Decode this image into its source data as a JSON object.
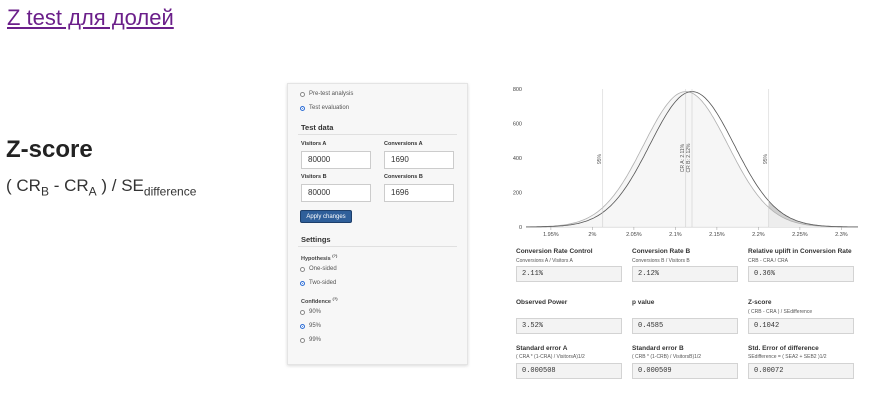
{
  "page_title": "Z test для долей",
  "zscore": {
    "heading": "Z-score",
    "formula_open": "( CR",
    "formula_sub_b": "B",
    "formula_minus": " - CR",
    "formula_sub_a": "A",
    "formula_close": " ) / SE",
    "formula_sub_diff": "difference"
  },
  "analysis_type": {
    "options": [
      {
        "label": "Pre-test analysis",
        "selected": false
      },
      {
        "label": "Test evaluation",
        "selected": true
      }
    ]
  },
  "test_data": {
    "heading": "Test data",
    "visitors_a_label": "Visitors A",
    "visitors_a": "80000",
    "conversions_a_label": "Conversions A",
    "conversions_a": "1690",
    "visitors_b_label": "Visitors B",
    "visitors_b": "80000",
    "conversions_b_label": "Conversions B",
    "conversions_b": "1696",
    "apply_label": "Apply changes"
  },
  "settings": {
    "heading": "Settings",
    "hypothesis_label": "Hypothesis",
    "hypothesis_sup": "(?)",
    "hypothesis_options": [
      {
        "label": "One-sided",
        "selected": false
      },
      {
        "label": "Two-sided",
        "selected": true
      }
    ],
    "confidence_label": "Confidence",
    "confidence_sup": "(?)",
    "confidence_options": [
      {
        "label": "90%",
        "selected": false
      },
      {
        "label": "95%",
        "selected": true
      },
      {
        "label": "99%",
        "selected": false
      }
    ]
  },
  "chart_data": {
    "type": "line",
    "y_ticks": [
      "800",
      "600",
      "400",
      "200",
      "0"
    ],
    "ylim": [
      0,
      800
    ],
    "x_ticks": [
      "1.95%",
      "2%",
      "2.05%",
      "2.1%",
      "2.15%",
      "2.2%",
      "2.25%",
      "2.3%"
    ],
    "xlim": [
      1.92,
      2.32
    ],
    "series": [
      {
        "name": "CR A: 2.11%",
        "mean": 2.1125,
        "sd": 0.0508,
        "peak": 785
      },
      {
        "name": "CR B: 2.12%",
        "mean": 2.12,
        "sd": 0.0509,
        "peak": 785
      }
    ],
    "annotations": [
      {
        "text": "95%",
        "x": 2.0125
      },
      {
        "text": "95%",
        "x": 2.2125
      },
      {
        "text": "CR A: 2.11%",
        "x": 2.1125
      },
      {
        "text": "CR B: 2.12%",
        "x": 2.12
      }
    ],
    "shaded_tail_from": 2.2125,
    "grid": false
  },
  "metrics": {
    "cr_control": {
      "label": "Conversion Rate Control",
      "sub": "Conversions A / Visitors A",
      "value": "2.11%"
    },
    "cr_b": {
      "label": "Conversion Rate B",
      "sub": "Conversions B / Visitors B",
      "value": "2.12%"
    },
    "uplift": {
      "label": "Relative uplift in Conversion Rate",
      "sub": "CRB - CRA / CRA",
      "value": "0.36%"
    },
    "power": {
      "label": "Observed Power",
      "sub": "",
      "value": "3.52%"
    },
    "pvalue": {
      "label": "p value",
      "sub": "",
      "value": "0.4585"
    },
    "zscore": {
      "label": "Z-score",
      "sub": "( CRB - CRA ) / SEdifference",
      "value": "0.1042"
    },
    "se_a": {
      "label": "Standard error A",
      "sub": "( CRA * (1-CRA) / VisitorsA)1/2",
      "value": "0.000508"
    },
    "se_b": {
      "label": "Standard error B",
      "sub": "( CRB * (1-CRB) / VisitorsB)1/2",
      "value": "0.000509"
    },
    "se_diff": {
      "label": "Std. Error of difference",
      "sub": "SEdifference = ( SEA2 + SEB2 )1/2",
      "value": "0.00072"
    }
  },
  "colors": {
    "link": "#6b1f8a",
    "button": "#2f5f9a",
    "radio_selected": "#2f6fd6"
  }
}
